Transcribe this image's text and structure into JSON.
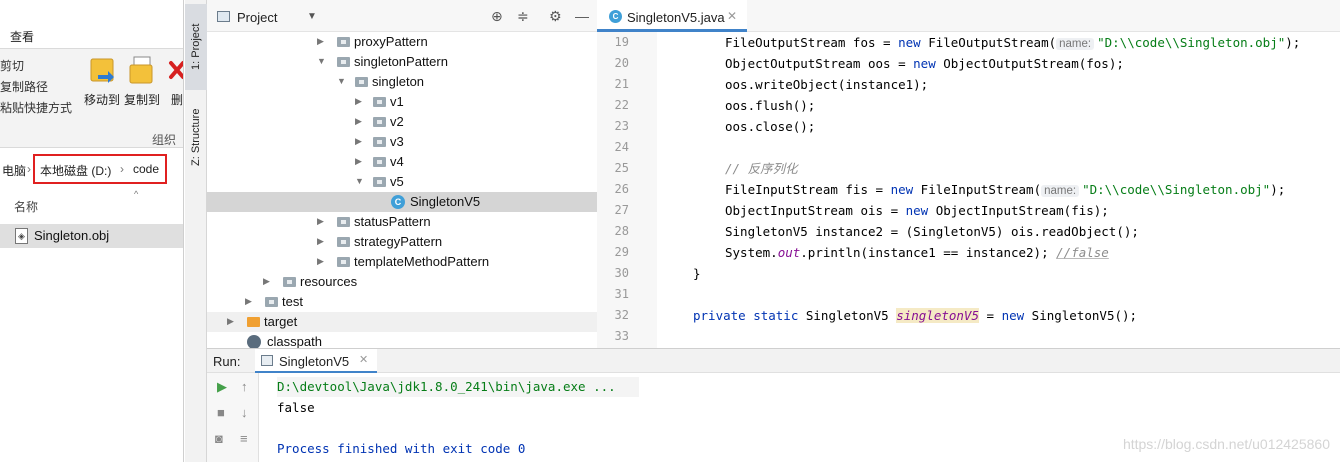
{
  "explorer": {
    "ribbon_tab": "查看",
    "ribbon_small": [
      "剪切",
      "复制路径",
      "粘贴快捷方式"
    ],
    "move_to": "移动到",
    "copy_to": "复制到",
    "delete_short": "删",
    "group_label": "组织",
    "address": {
      "computer": "电脑",
      "drive": "本地磁盘 (D:)",
      "folder": "code"
    },
    "column_name": "名称",
    "file_name": "Singleton.obj"
  },
  "ide": {
    "side_tabs": {
      "project": "1: Project",
      "structure": "Z: Structure"
    },
    "project_title": "Project",
    "tree": [
      {
        "label": "proxyPattern"
      },
      {
        "label": "singletonPattern"
      },
      {
        "label": "singleton"
      },
      {
        "label": "v1"
      },
      {
        "label": "v2"
      },
      {
        "label": "v3"
      },
      {
        "label": "v4"
      },
      {
        "label": "v5"
      },
      {
        "label": "SingletonV5"
      },
      {
        "label": "statusPattern"
      },
      {
        "label": "strategyPattern"
      },
      {
        "label": "templateMethodPattern"
      },
      {
        "label": "resources"
      },
      {
        "label": "test"
      },
      {
        "label": "target"
      },
      {
        "label": "classpath"
      }
    ],
    "editor_tab": "SingletonV5.java",
    "line_numbers": [
      "19",
      "20",
      "21",
      "22",
      "23",
      "24",
      "25",
      "26",
      "27",
      "28",
      "29",
      "30",
      "31",
      "32",
      "33"
    ],
    "code": {
      "l19": {
        "a": "FileOutputStream fos = ",
        "kw": "new",
        "b": " FileOutputStream(",
        "hint": "name:",
        "str": "\"D:\\\\code\\\\Singleton.obj\"",
        "c": ");"
      },
      "l20": {
        "a": "ObjectOutputStream oos = ",
        "kw": "new",
        "b": " ObjectOutputStream(fos);"
      },
      "l21": "oos.writeObject(instance1);",
      "l22": "oos.flush();",
      "l23": "oos.close();",
      "l25": "// 反序列化",
      "l26": {
        "a": "FileInputStream fis = ",
        "kw": "new",
        "b": " FileInputStream(",
        "hint": "name:",
        "str": "\"D:\\\\code\\\\Singleton.obj\"",
        "c": ");"
      },
      "l27": {
        "a": "ObjectInputStream ois = ",
        "kw": "new",
        "b": " ObjectInputStream(fis);"
      },
      "l28": "SingletonV5 instance2 = (SingletonV5) ois.readObject();",
      "l29": {
        "a": "System.",
        "fld": "out",
        "b": ".println(instance1 == instance2); ",
        "cmt": "//false"
      },
      "l30": "}",
      "l32": {
        "kw": "private static",
        "a": " SingletonV5 ",
        "fld": "singletonV5",
        "b": " = ",
        "kw2": "new",
        "c": " SingletonV5();"
      }
    },
    "run": {
      "label": "Run:",
      "tab": "SingletonV5",
      "cmd": "D:\\devtool\\Java\\jdk1.8.0_241\\bin\\java.exe ...",
      "output": "false",
      "finished": "Process finished with exit code 0"
    }
  },
  "watermark": "https://blog.csdn.net/u012425860"
}
